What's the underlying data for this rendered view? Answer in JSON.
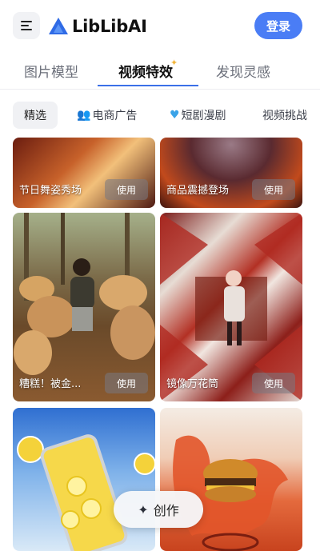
{
  "header": {
    "logo_text": "LibLibAI",
    "login_label": "登录"
  },
  "tabs": [
    {
      "label": "图片模型",
      "active": false
    },
    {
      "label": "视频特效",
      "active": true
    },
    {
      "label": "发现灵感",
      "active": false
    }
  ],
  "chips": [
    {
      "label": "精选",
      "icon": "",
      "selected": true
    },
    {
      "label": "电商广告",
      "icon": "people-icon",
      "selected": false
    },
    {
      "label": "短剧漫剧",
      "icon": "heart-icon",
      "selected": false
    },
    {
      "label": "视频挑战",
      "icon": "",
      "selected": false
    }
  ],
  "cards": [
    {
      "title": "节日舞姿秀场",
      "action": "使用"
    },
    {
      "title": "商品震撼登场",
      "action": "使用"
    },
    {
      "title": "糟糕！被金...",
      "action": "使用"
    },
    {
      "title": "镜像万花筒",
      "action": "使用"
    },
    {
      "title": "",
      "action": ""
    },
    {
      "title": "",
      "action": ""
    }
  ],
  "create_button": {
    "label": "创作",
    "icon": "sparkle-icon"
  },
  "colors": {
    "accent": "#4a7df5",
    "tab_indicator": "#3b6fe8"
  }
}
